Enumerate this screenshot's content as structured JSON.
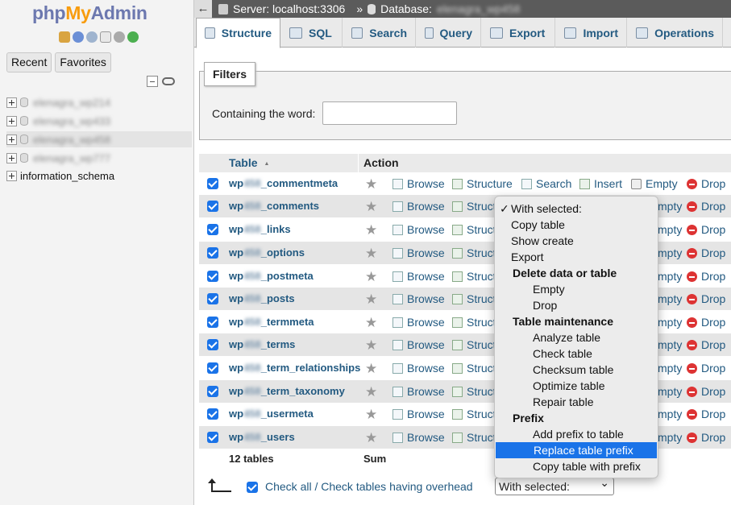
{
  "sidebar": {
    "logo_php": "php",
    "logo_my": "My",
    "logo_admin": "Admin",
    "recent": "Recent",
    "favorites": "Favorites",
    "databases": [
      {
        "name": "elenagra_wp214",
        "blurred": true
      },
      {
        "name": "elenagra_wp433",
        "blurred": true
      },
      {
        "name": "elenagra_wp458",
        "blurred": true,
        "highlighted": true
      },
      {
        "name": "elenagra_wp777",
        "blurred": true
      },
      {
        "name": "information_schema",
        "blurred": false
      }
    ]
  },
  "breadcrumb": {
    "server": "Server: localhost:3306",
    "sep": "»",
    "database": "Database:",
    "database_name": "elenagra_wp458"
  },
  "tabs": [
    {
      "label": "Structure",
      "active": true
    },
    {
      "label": "SQL"
    },
    {
      "label": "Search"
    },
    {
      "label": "Query"
    },
    {
      "label": "Export"
    },
    {
      "label": "Import"
    },
    {
      "label": "Operations"
    }
  ],
  "filters": {
    "legend": "Filters",
    "containing": "Containing the word:",
    "value": ""
  },
  "table_head": {
    "table": "Table",
    "action": "Action"
  },
  "actions": {
    "browse": "Browse",
    "structure": "Structure",
    "struct_trunc": "Struct",
    "search": "Search",
    "insert": "Insert",
    "empty": "Empty",
    "empty_trunc": "mpty",
    "drop": "Drop"
  },
  "tables": [
    {
      "prefix": "wp",
      "blur": "458",
      "name": "_commentmeta"
    },
    {
      "prefix": "wp",
      "blur": "458",
      "name": "_comments"
    },
    {
      "prefix": "wp",
      "blur": "458",
      "name": "_links"
    },
    {
      "prefix": "wp",
      "blur": "458",
      "name": "_options"
    },
    {
      "prefix": "wp",
      "blur": "458",
      "name": "_postmeta"
    },
    {
      "prefix": "wp",
      "blur": "458",
      "name": "_posts"
    },
    {
      "prefix": "wp",
      "blur": "458",
      "name": "_termmeta"
    },
    {
      "prefix": "wp",
      "blur": "458",
      "name": "_terms"
    },
    {
      "prefix": "wp",
      "blur": "458",
      "name": "_term_relationships"
    },
    {
      "prefix": "wp",
      "blur": "458",
      "name": "_term_taxonomy"
    },
    {
      "prefix": "wp",
      "blur": "458",
      "name": "_usermeta"
    },
    {
      "prefix": "wp",
      "blur": "458",
      "name": "_users"
    }
  ],
  "summary": {
    "count": "12 tables",
    "sum": "Sum"
  },
  "footer": {
    "check_all": "Check all / Check tables having overhead",
    "with_selected": "With selected:"
  },
  "menu": {
    "items": [
      {
        "label": "With selected:",
        "kind": "top",
        "checked": true
      },
      {
        "label": "Copy table",
        "kind": "top"
      },
      {
        "label": "Show create",
        "kind": "top"
      },
      {
        "label": "Export",
        "kind": "top"
      },
      {
        "label": "Delete data or table",
        "kind": "grp"
      },
      {
        "label": "Empty",
        "kind": "sub"
      },
      {
        "label": "Drop",
        "kind": "sub"
      },
      {
        "label": "Table maintenance",
        "kind": "grp"
      },
      {
        "label": "Analyze table",
        "kind": "sub"
      },
      {
        "label": "Check table",
        "kind": "sub"
      },
      {
        "label": "Checksum table",
        "kind": "sub"
      },
      {
        "label": "Optimize table",
        "kind": "sub"
      },
      {
        "label": "Repair table",
        "kind": "sub"
      },
      {
        "label": "Prefix",
        "kind": "grp"
      },
      {
        "label": "Add prefix to table",
        "kind": "sub"
      },
      {
        "label": "Replace table prefix",
        "kind": "sub",
        "selected": true
      },
      {
        "label": "Copy table with prefix",
        "kind": "sub"
      }
    ]
  },
  "colors": {
    "link": "#235a81",
    "accent": "#1a73e8",
    "drop": "#d33333"
  }
}
